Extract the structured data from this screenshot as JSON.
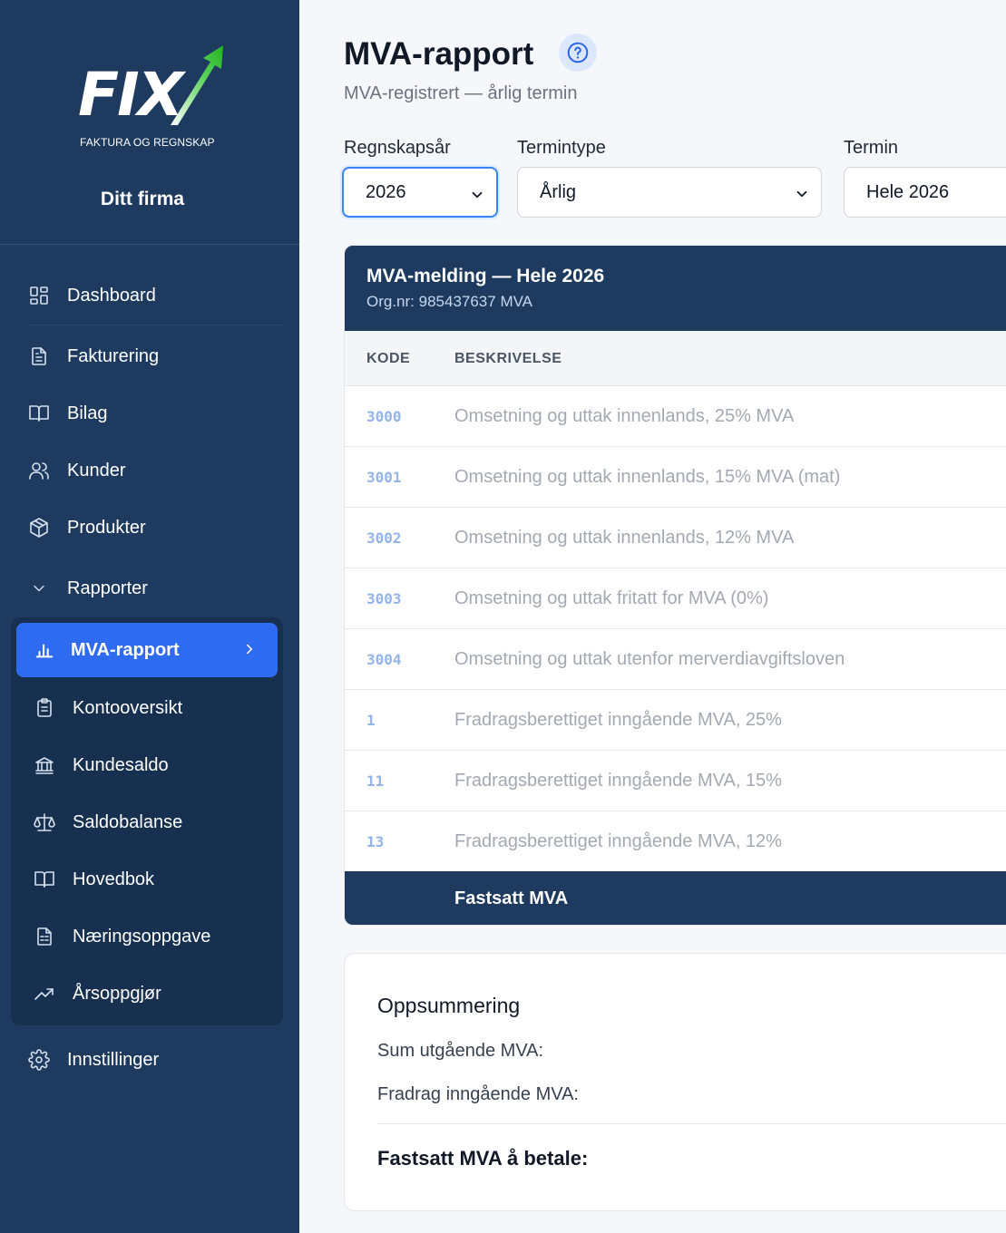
{
  "brand": {
    "logo_text": "FIX",
    "tagline": "FAKTURA OG REGNSKAP",
    "company": "Ditt firma"
  },
  "nav": {
    "items": [
      {
        "label": "Dashboard",
        "icon": "dashboard-icon"
      },
      {
        "label": "Fakturering",
        "icon": "document-icon"
      },
      {
        "label": "Bilag",
        "icon": "book-open-icon"
      },
      {
        "label": "Kunder",
        "icon": "users-icon"
      },
      {
        "label": "Produkter",
        "icon": "package-icon"
      },
      {
        "label": "Rapporter",
        "icon": "chevron-down-icon"
      }
    ],
    "reports": [
      {
        "label": "MVA-rapport",
        "icon": "bar-chart-icon",
        "active": true
      },
      {
        "label": "Kontooversikt",
        "icon": "clipboard-icon"
      },
      {
        "label": "Kundesaldo",
        "icon": "bank-icon"
      },
      {
        "label": "Saldobalanse",
        "icon": "scale-icon"
      },
      {
        "label": "Hovedbok",
        "icon": "book-open-icon"
      },
      {
        "label": "Næringsoppgave",
        "icon": "spreadsheet-icon"
      },
      {
        "label": "Årsoppgjør",
        "icon": "trending-up-icon"
      }
    ],
    "settings": {
      "label": "Innstillinger",
      "icon": "gear-icon"
    }
  },
  "page": {
    "title": "MVA-rapport",
    "subtitle": "MVA-registrert — årlig termin"
  },
  "filters": {
    "year": {
      "label": "Regnskapsår",
      "value": "2026"
    },
    "term_type": {
      "label": "Termintype",
      "value": "Årlig"
    },
    "term": {
      "label": "Termin",
      "value": "Hele 2026"
    }
  },
  "report": {
    "title": "MVA-melding — Hele 2026",
    "org": "Org.nr: 985437637 MVA",
    "columns": {
      "code": "KODE",
      "description": "BESKRIVELSE"
    },
    "rows": [
      {
        "code": "3000",
        "description": "Omsetning og uttak innenlands, 25% MVA"
      },
      {
        "code": "3001",
        "description": "Omsetning og uttak innenlands, 15% MVA (mat)"
      },
      {
        "code": "3002",
        "description": "Omsetning og uttak innenlands, 12% MVA"
      },
      {
        "code": "3003",
        "description": "Omsetning og uttak fritatt for MVA (0%)"
      },
      {
        "code": "3004",
        "description": "Omsetning og uttak utenfor merverdiavgiftsloven"
      },
      {
        "code": "1",
        "description": "Fradragsberettiget inngående MVA, 25%"
      },
      {
        "code": "11",
        "description": "Fradragsberettiget inngående MVA, 15%"
      },
      {
        "code": "13",
        "description": "Fradragsberettiget inngående MVA, 12%"
      }
    ],
    "footer": "Fastsatt MVA"
  },
  "summary": {
    "title": "Oppsummering",
    "out_label": "Sum utgående MVA:",
    "in_label": "Fradrag inngående MVA:",
    "total_label": "Fastsatt MVA å betale:"
  },
  "colors": {
    "sidebar": "#1e3a5f",
    "accent": "#2f6bf0",
    "code": "#93b4e8"
  }
}
